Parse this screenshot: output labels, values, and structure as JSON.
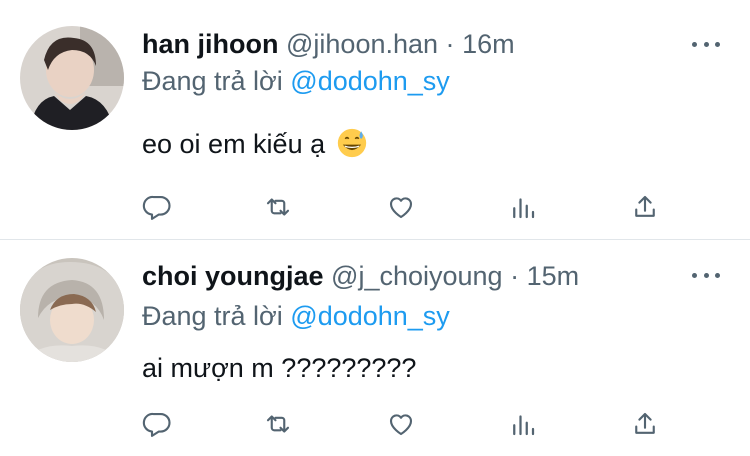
{
  "tweets": [
    {
      "name": "han jihoon",
      "handle": "@jihoon.han",
      "separator": "·",
      "time": "16m",
      "reply_prefix": "Đang trả lời",
      "reply_to": "@dodohn_sy",
      "text": "eo oi em kiếu ạ",
      "emoji": "grinning-sweat-emoji"
    },
    {
      "name": "choi youngjae",
      "handle": "@j_choiyoung",
      "separator": "·",
      "time": "15m",
      "reply_prefix": "Đang trả lời",
      "reply_to": "@dodohn_sy",
      "text": "ai mượn m ?????????"
    }
  ],
  "actions": [
    "reply-icon",
    "retweet-icon",
    "like-icon",
    "analytics-icon",
    "share-icon"
  ],
  "colors": {
    "text": "#0f1419",
    "secondary": "#536471",
    "mention": "#1d9bf0",
    "divider": "#e1e6ea"
  }
}
